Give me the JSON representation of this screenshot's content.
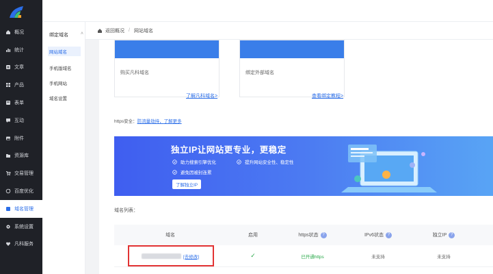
{
  "sidebar": {
    "items": [
      {
        "label": "概况",
        "icon": "home-icon"
      },
      {
        "label": "统计",
        "icon": "chart-icon"
      },
      {
        "label": "文章",
        "icon": "document-icon"
      },
      {
        "label": "产品",
        "icon": "grid-icon"
      },
      {
        "label": "表单",
        "icon": "form-icon"
      },
      {
        "label": "互动",
        "icon": "chat-icon"
      },
      {
        "label": "附件",
        "icon": "image-icon"
      },
      {
        "label": "资源库",
        "icon": "folder-icon"
      },
      {
        "label": "交易管理",
        "icon": "cart-icon"
      },
      {
        "label": "百度优化",
        "icon": "refresh-icon"
      },
      {
        "label": "域名管理",
        "icon": "globe-icon",
        "active": true
      },
      {
        "label": "系统设置",
        "icon": "gear-icon"
      },
      {
        "label": "凡科服务",
        "icon": "heart-icon"
      }
    ]
  },
  "submenu": {
    "group": "绑定域名",
    "items": [
      "网站域名",
      "手机版域名",
      "手机网站",
      "域名设置"
    ]
  },
  "breadcrumb": {
    "back": "返回概况",
    "current": "网站域名"
  },
  "cards": {
    "card_a_label": "购买凡科域名",
    "card_a_link": "了解凡科域名>",
    "card_b_label": "绑定外部域名",
    "card_b_link": "查看绑定教程>"
  },
  "https": {
    "label": "https安全：",
    "link1": "防流量劫持，",
    "link2": "了解更多"
  },
  "banner": {
    "title": "独立IP让网站更专业，更稳定",
    "feature1": "助力搜索引擎优化",
    "feature2": "提升网站安全性、稳定性",
    "feature3": "避免因被封连累",
    "cta": "了解独立IP"
  },
  "domain_list": {
    "title": "域名列表：",
    "headers": [
      "域名",
      "启用",
      "https状态",
      "IPv6状态",
      "独立IP"
    ],
    "rows": [
      {
        "domain_link": "[去修改]",
        "enabled": "✓",
        "https": "已开通https",
        "ipv6": "未支持",
        "ip": "未支持"
      }
    ]
  },
  "colors": {
    "accent": "#2b6ee8",
    "sidebar": "#1f2127",
    "highlight": "#e23232",
    "success": "#2aa94a"
  }
}
